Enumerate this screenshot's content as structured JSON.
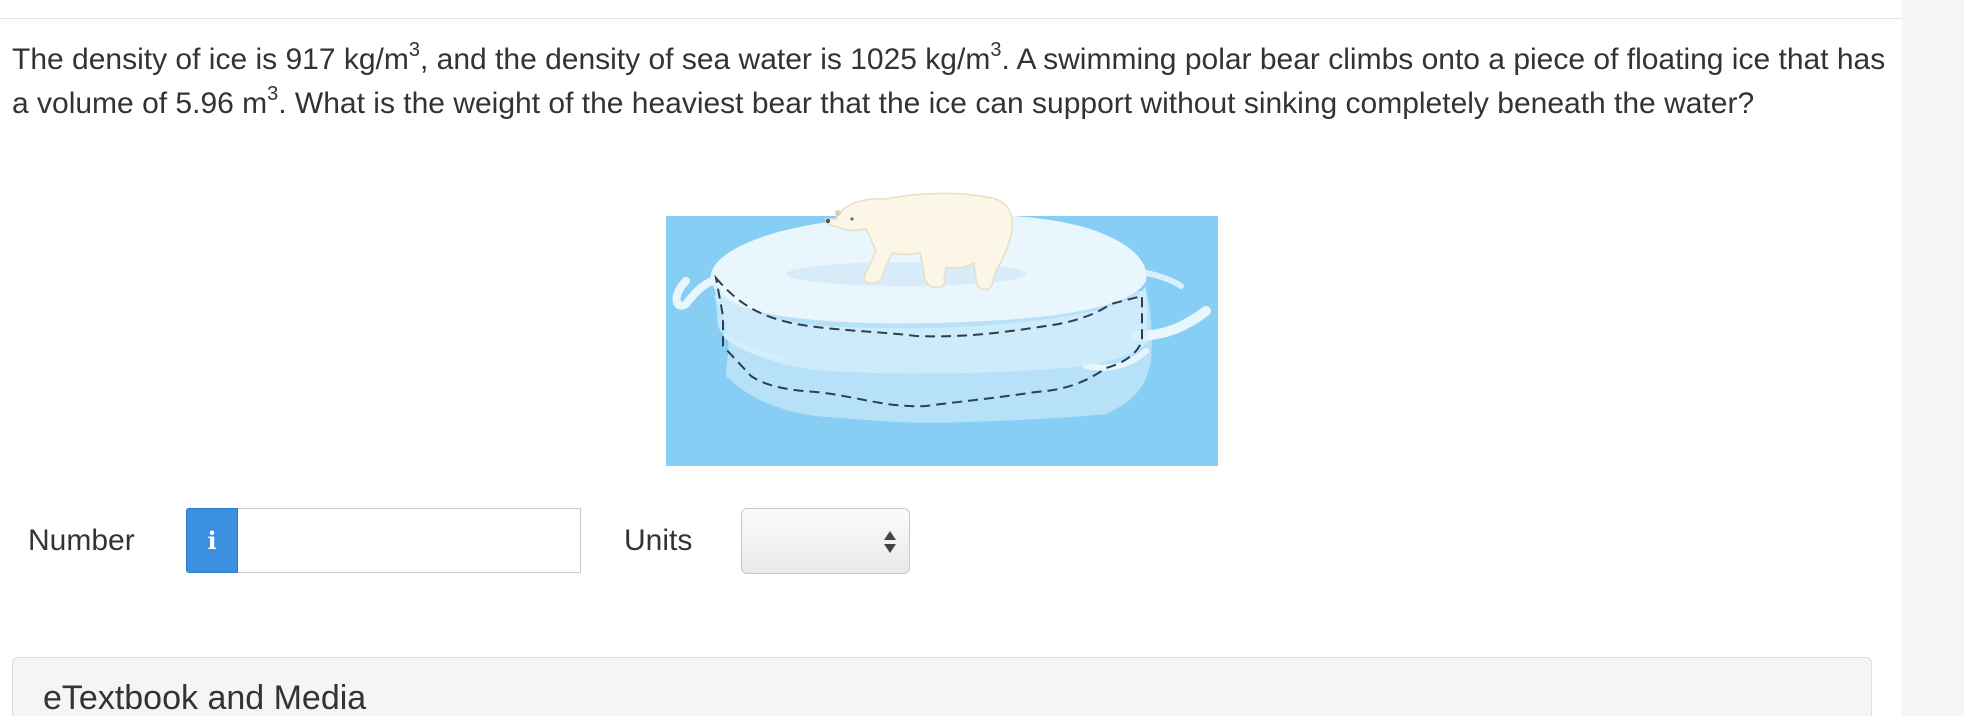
{
  "question": {
    "part1": "The density of ice is 917 kg/m",
    "sup1": "3",
    "part2": ", and the density of sea water is 1025 kg/m",
    "sup2": "3",
    "part3": ". A swimming polar bear climbs onto a piece of floating ice that has a volume of 5.96 m",
    "sup3": "3",
    "part4": ". What is the weight of the heaviest bear that the ice can support without sinking completely beneath the water?"
  },
  "answer": {
    "number_label": "Number",
    "info_icon": "i",
    "number_value": "",
    "units_label": "Units",
    "units_selected": ""
  },
  "etextbook": {
    "title": "eTextbook and Media"
  },
  "colors": {
    "water": "#87CEF2",
    "info_button": "#3b8fe0"
  }
}
